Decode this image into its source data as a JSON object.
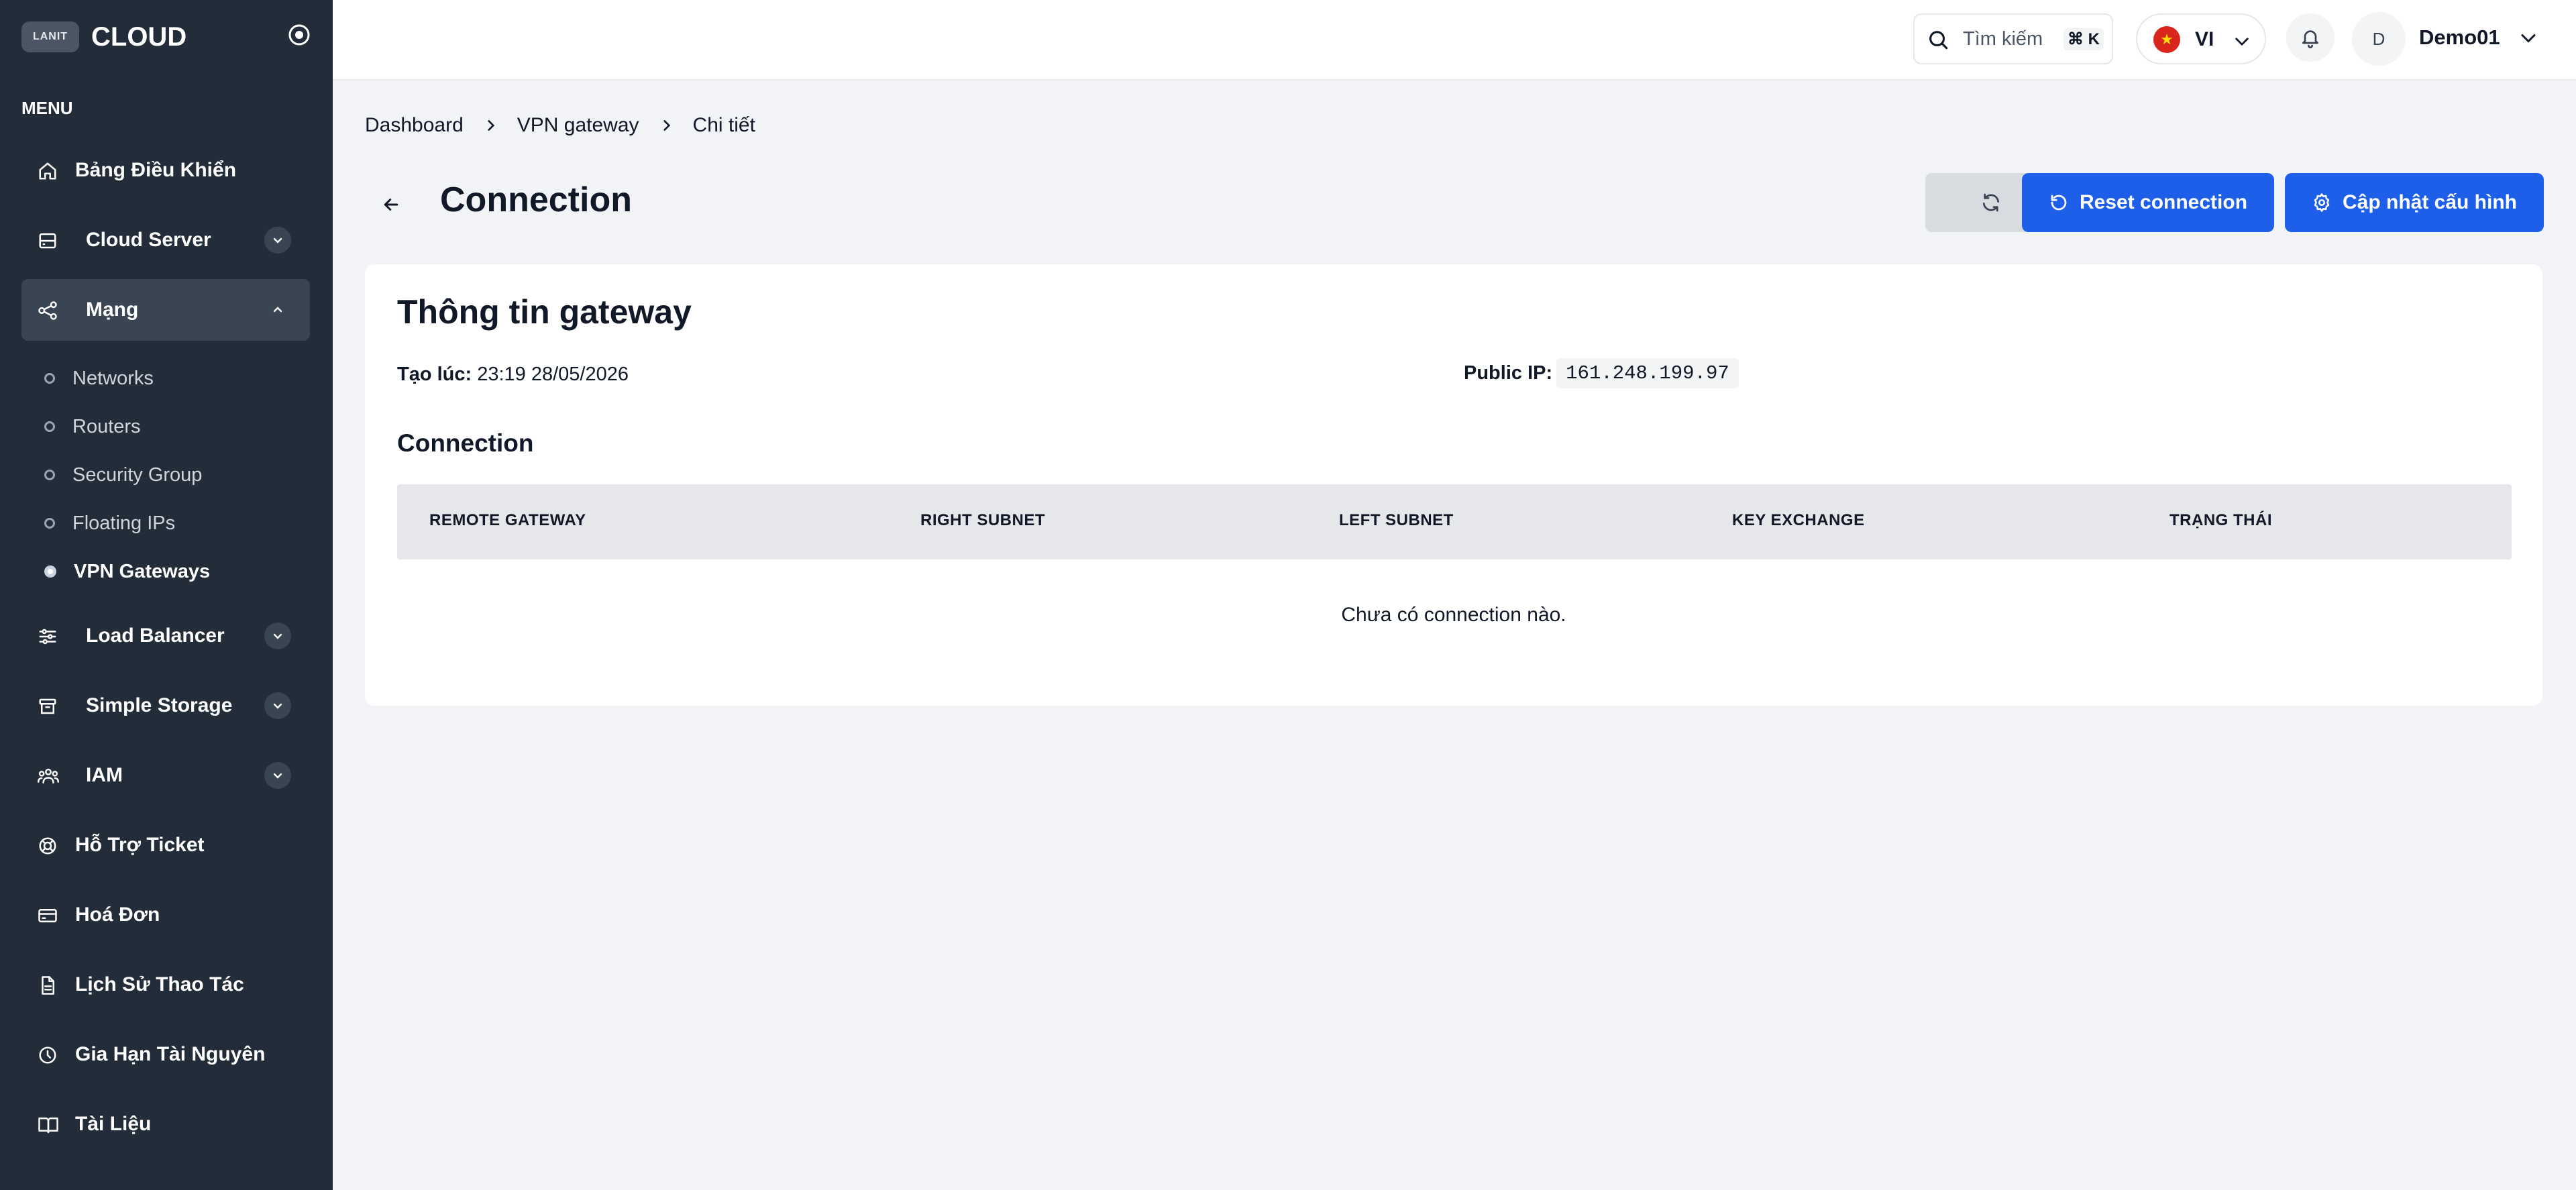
{
  "brand": {
    "logo": "LANIT",
    "name": "CLOUD"
  },
  "sidebar": {
    "heading": "MENU",
    "items": [
      {
        "label": "Bảng Điều Khiển",
        "icon": "home-icon"
      },
      {
        "label": "Cloud Server",
        "icon": "server-icon"
      },
      {
        "label": "Mạng",
        "icon": "network-icon"
      },
      {
        "label": "Load Balancer",
        "icon": "sliders-icon"
      },
      {
        "label": "Simple Storage",
        "icon": "archive-icon"
      },
      {
        "label": "IAM",
        "icon": "users-icon"
      },
      {
        "label": "Hỗ Trợ Ticket",
        "icon": "lifebuoy-icon"
      },
      {
        "label": "Hoá Đơn",
        "icon": "credit-card-icon"
      },
      {
        "label": "Lịch Sử Thao Tác",
        "icon": "document-icon"
      },
      {
        "label": "Gia Hạn Tài Nguyên",
        "icon": "clock-icon"
      },
      {
        "label": "Tài Liệu",
        "icon": "book-icon"
      }
    ],
    "network_sub": [
      "Networks",
      "Routers",
      "Security Group",
      "Floating IPs",
      "VPN Gateways"
    ]
  },
  "header": {
    "search_label": "Tìm kiếm",
    "search_shortcut": "⌘ K",
    "lang": "VI",
    "avatar_initial": "D",
    "user_name": "Demo01"
  },
  "breadcrumb": [
    "Dashboard",
    "VPN gateway",
    "Chi tiết"
  ],
  "page": {
    "title": "Connection",
    "reset_button": "Reset connection",
    "config_button": "Cập nhật cấu hình"
  },
  "gateway": {
    "card_title": "Thông tin gateway",
    "created_label": "Tạo lúc:",
    "created_value": "23:19 28/05/2026",
    "public_ip_label": "Public IP:",
    "public_ip_value": "161.248.199.97"
  },
  "connections": {
    "section_title": "Connection",
    "columns": [
      "REMOTE GATEWAY",
      "RIGHT SUBNET",
      "LEFT SUBNET",
      "KEY EXCHANGE",
      "TRẠNG THÁI"
    ],
    "empty_message": "Chưa có connection nào."
  }
}
